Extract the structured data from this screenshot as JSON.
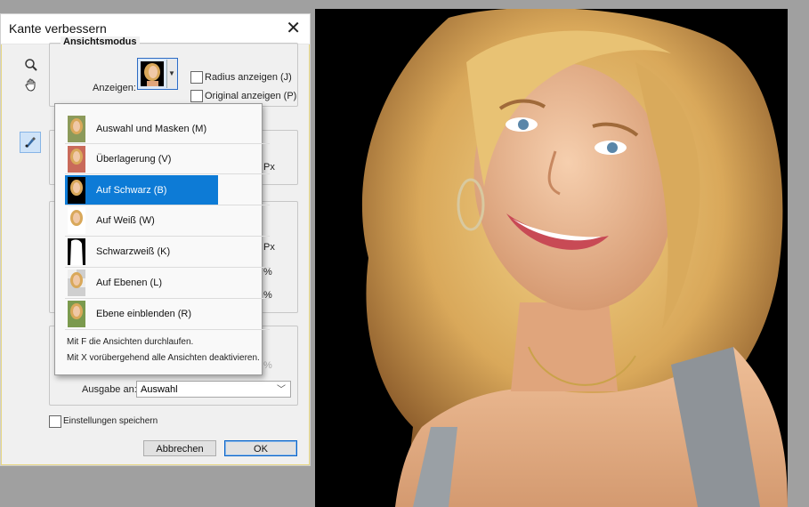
{
  "dialog": {
    "title": "Kante verbessern",
    "close_glyph": "✕",
    "view_section_title": "Ansichtsmodus",
    "show_label": "Anzeigen:",
    "radius_checkbox": "Radius anzeigen (J)",
    "original_checkbox": "Original anzeigen (P)",
    "unit_px_1": "Px",
    "unit_px_2": "Px",
    "unit_pct_1": "%",
    "unit_pct_2": "%",
    "unit_pct_3": "%",
    "output_label": "Ausgabe an:",
    "output_value": "Auswahl",
    "save_settings": "Einstellungen speichern",
    "cancel_label": "Abbrechen",
    "ok_label": "OK"
  },
  "tools": [
    "zoom-icon",
    "hand-icon",
    "refine-radius-brush-icon"
  ],
  "view_menu": {
    "items": [
      {
        "label": "Auswahl und Masken (M)",
        "selected": false
      },
      {
        "label": "Überlagerung (V)",
        "selected": false
      },
      {
        "label": "Auf Schwarz (B)",
        "selected": true
      },
      {
        "label": "Auf Weiß (W)",
        "selected": false
      },
      {
        "label": "Schwarzweiß (K)",
        "selected": false
      },
      {
        "label": "Auf Ebenen (L)",
        "selected": false
      },
      {
        "label": "Ebene einblenden (R)",
        "selected": false
      }
    ],
    "hint_1": "Mit F die Ansichten durchlaufen.",
    "hint_2": "Mit X vorübergehend alle Ansichten deaktivieren."
  },
  "colors": {
    "selection": "#0d7bd6",
    "canvas_bg": "#000000",
    "ok_border": "#0a64c8"
  }
}
